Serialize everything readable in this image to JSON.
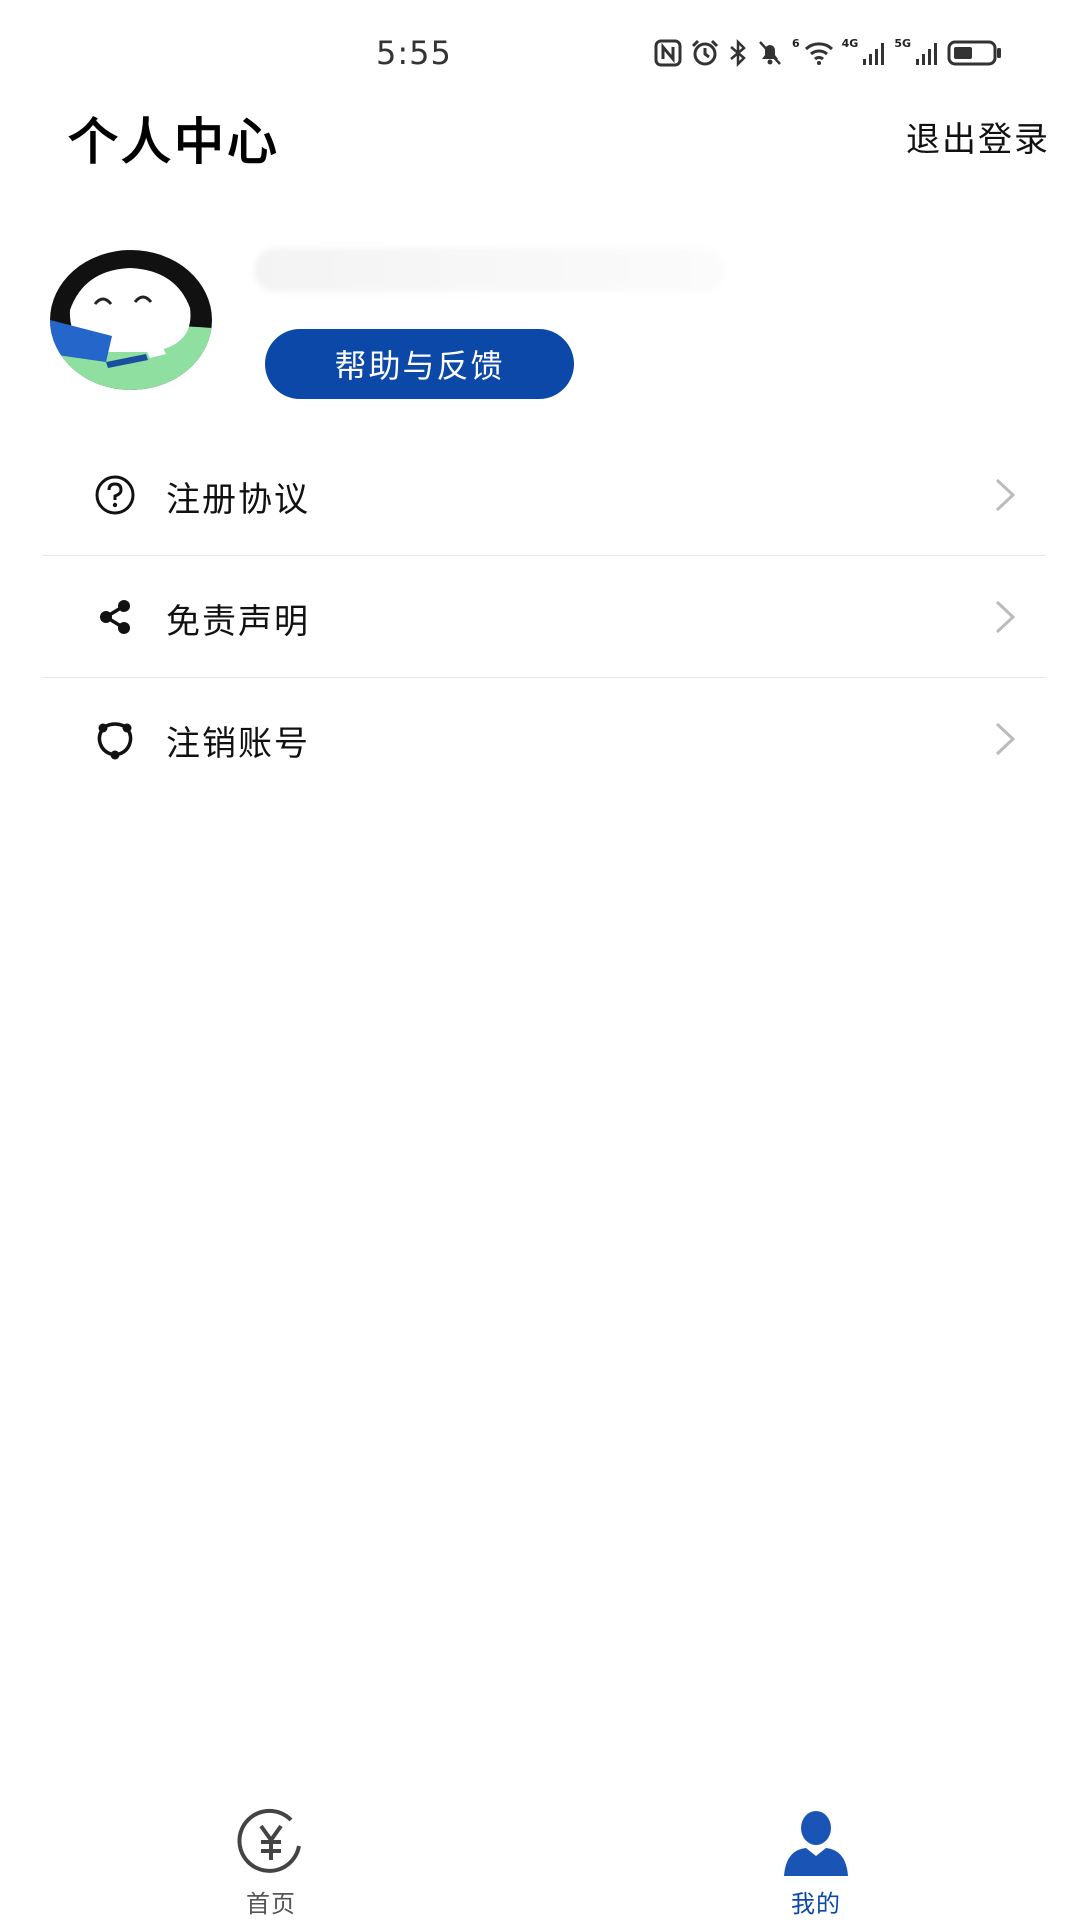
{
  "status_bar": {
    "time": "5:55",
    "network_left": "4G",
    "network_right": "5G",
    "wifi_label": "6",
    "icons": [
      "nfc-icon",
      "alarm-icon",
      "bluetooth-icon",
      "mute-icon",
      "wifi-icon",
      "signal-icon",
      "signal-icon",
      "battery-icon"
    ],
    "battery_level": 0.5
  },
  "header": {
    "title": "个人中心",
    "logout_label": "退出登录"
  },
  "profile": {
    "help_button_label": "帮助与反馈"
  },
  "menu": {
    "items": [
      {
        "label": "注册协议",
        "icon": "question-circle-icon"
      },
      {
        "label": "免责声明",
        "icon": "share-icon"
      },
      {
        "label": "注销账号",
        "icon": "cycle-icon"
      }
    ]
  },
  "bottom_nav": {
    "items": [
      {
        "label": "首页",
        "icon": "yen-circle-icon",
        "active": false
      },
      {
        "label": "我的",
        "icon": "user-icon",
        "active": true
      }
    ]
  },
  "colors": {
    "accent": "#0b48a8",
    "divider": "#e6e6e6",
    "chevron": "#bbbbbb"
  }
}
